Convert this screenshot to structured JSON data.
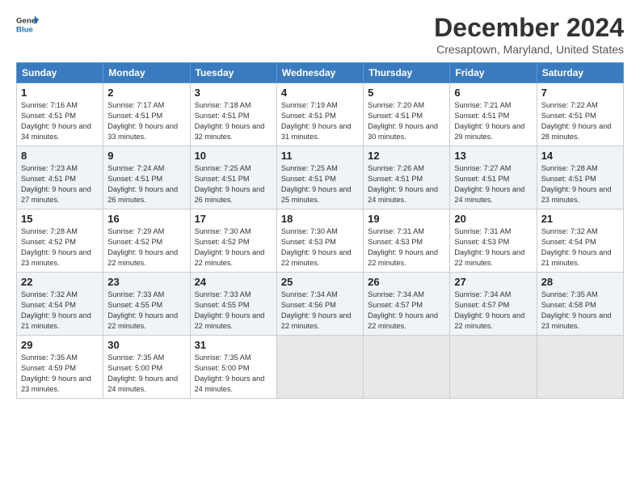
{
  "logo": {
    "line1": "General",
    "line2": "Blue"
  },
  "title": "December 2024",
  "location": "Cresaptown, Maryland, United States",
  "days_of_week": [
    "Sunday",
    "Monday",
    "Tuesday",
    "Wednesday",
    "Thursday",
    "Friday",
    "Saturday"
  ],
  "weeks": [
    [
      {
        "day": "1",
        "sunrise": "7:16 AM",
        "sunset": "4:51 PM",
        "daylight": "9 hours and 34 minutes."
      },
      {
        "day": "2",
        "sunrise": "7:17 AM",
        "sunset": "4:51 PM",
        "daylight": "9 hours and 33 minutes."
      },
      {
        "day": "3",
        "sunrise": "7:18 AM",
        "sunset": "4:51 PM",
        "daylight": "9 hours and 32 minutes."
      },
      {
        "day": "4",
        "sunrise": "7:19 AM",
        "sunset": "4:51 PM",
        "daylight": "9 hours and 31 minutes."
      },
      {
        "day": "5",
        "sunrise": "7:20 AM",
        "sunset": "4:51 PM",
        "daylight": "9 hours and 30 minutes."
      },
      {
        "day": "6",
        "sunrise": "7:21 AM",
        "sunset": "4:51 PM",
        "daylight": "9 hours and 29 minutes."
      },
      {
        "day": "7",
        "sunrise": "7:22 AM",
        "sunset": "4:51 PM",
        "daylight": "9 hours and 28 minutes."
      }
    ],
    [
      {
        "day": "8",
        "sunrise": "7:23 AM",
        "sunset": "4:51 PM",
        "daylight": "9 hours and 27 minutes."
      },
      {
        "day": "9",
        "sunrise": "7:24 AM",
        "sunset": "4:51 PM",
        "daylight": "9 hours and 26 minutes."
      },
      {
        "day": "10",
        "sunrise": "7:25 AM",
        "sunset": "4:51 PM",
        "daylight": "9 hours and 26 minutes."
      },
      {
        "day": "11",
        "sunrise": "7:25 AM",
        "sunset": "4:51 PM",
        "daylight": "9 hours and 25 minutes."
      },
      {
        "day": "12",
        "sunrise": "7:26 AM",
        "sunset": "4:51 PM",
        "daylight": "9 hours and 24 minutes."
      },
      {
        "day": "13",
        "sunrise": "7:27 AM",
        "sunset": "4:51 PM",
        "daylight": "9 hours and 24 minutes."
      },
      {
        "day": "14",
        "sunrise": "7:28 AM",
        "sunset": "4:51 PM",
        "daylight": "9 hours and 23 minutes."
      }
    ],
    [
      {
        "day": "15",
        "sunrise": "7:28 AM",
        "sunset": "4:52 PM",
        "daylight": "9 hours and 23 minutes."
      },
      {
        "day": "16",
        "sunrise": "7:29 AM",
        "sunset": "4:52 PM",
        "daylight": "9 hours and 22 minutes."
      },
      {
        "day": "17",
        "sunrise": "7:30 AM",
        "sunset": "4:52 PM",
        "daylight": "9 hours and 22 minutes."
      },
      {
        "day": "18",
        "sunrise": "7:30 AM",
        "sunset": "4:53 PM",
        "daylight": "9 hours and 22 minutes."
      },
      {
        "day": "19",
        "sunrise": "7:31 AM",
        "sunset": "4:53 PM",
        "daylight": "9 hours and 22 minutes."
      },
      {
        "day": "20",
        "sunrise": "7:31 AM",
        "sunset": "4:53 PM",
        "daylight": "9 hours and 22 minutes."
      },
      {
        "day": "21",
        "sunrise": "7:32 AM",
        "sunset": "4:54 PM",
        "daylight": "9 hours and 21 minutes."
      }
    ],
    [
      {
        "day": "22",
        "sunrise": "7:32 AM",
        "sunset": "4:54 PM",
        "daylight": "9 hours and 21 minutes."
      },
      {
        "day": "23",
        "sunrise": "7:33 AM",
        "sunset": "4:55 PM",
        "daylight": "9 hours and 22 minutes."
      },
      {
        "day": "24",
        "sunrise": "7:33 AM",
        "sunset": "4:55 PM",
        "daylight": "9 hours and 22 minutes."
      },
      {
        "day": "25",
        "sunrise": "7:34 AM",
        "sunset": "4:56 PM",
        "daylight": "9 hours and 22 minutes."
      },
      {
        "day": "26",
        "sunrise": "7:34 AM",
        "sunset": "4:57 PM",
        "daylight": "9 hours and 22 minutes."
      },
      {
        "day": "27",
        "sunrise": "7:34 AM",
        "sunset": "4:57 PM",
        "daylight": "9 hours and 22 minutes."
      },
      {
        "day": "28",
        "sunrise": "7:35 AM",
        "sunset": "4:58 PM",
        "daylight": "9 hours and 23 minutes."
      }
    ],
    [
      {
        "day": "29",
        "sunrise": "7:35 AM",
        "sunset": "4:59 PM",
        "daylight": "9 hours and 23 minutes."
      },
      {
        "day": "30",
        "sunrise": "7:35 AM",
        "sunset": "5:00 PM",
        "daylight": "9 hours and 24 minutes."
      },
      {
        "day": "31",
        "sunrise": "7:35 AM",
        "sunset": "5:00 PM",
        "daylight": "9 hours and 24 minutes."
      },
      null,
      null,
      null,
      null
    ]
  ]
}
